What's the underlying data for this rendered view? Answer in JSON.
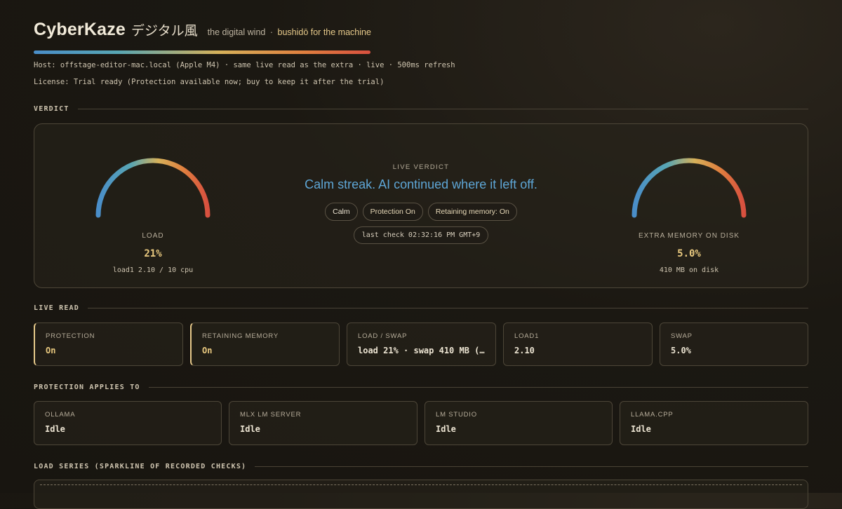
{
  "header": {
    "title": "CyberKaze",
    "title_jp": "デジタル風",
    "tagline_main": "the digital wind",
    "tagline_sep": "·",
    "tagline_accent": "bushidō for the machine",
    "host_line": "Host: offstage-editor-mac.local (Apple M4) · same live read as the extra · live · 500ms refresh",
    "license_line": "License: Trial ready (Protection available now; buy to keep it after the trial)"
  },
  "sections": {
    "verdict": "VERDICT",
    "live_read": "LIVE READ",
    "protection_applies": "PROTECTION APPLIES TO",
    "load_series": "LOAD SERIES (SPARKLINE OF RECORDED CHECKS)"
  },
  "verdict": {
    "load_gauge": {
      "label": "LOAD",
      "value": "21%",
      "sub": "load1 2.10 / 10 cpu",
      "fraction": 0.21
    },
    "disk_gauge": {
      "label": "EXTRA MEMORY ON DISK",
      "value": "5.0%",
      "sub": "410 MB on disk",
      "fraction": 0.05
    },
    "eyebrow": "LIVE VERDICT",
    "headline": "Calm streak. AI continued where it left off.",
    "chips": [
      "Calm",
      "Protection On",
      "Retaining memory: On"
    ],
    "last_check": "last check 02:32:16 PM GMT+9"
  },
  "live_read": [
    {
      "label": "PROTECTION",
      "value": "On"
    },
    {
      "label": "RETAINING MEMORY",
      "value": "On"
    },
    {
      "label": "LOAD / SWAP",
      "value": "load 21% · swap 410 MB (…"
    },
    {
      "label": "LOAD1",
      "value": "2.10"
    },
    {
      "label": "SWAP",
      "value": "5.0%"
    }
  ],
  "protection_targets": [
    {
      "label": "OLLAMA",
      "value": "Idle"
    },
    {
      "label": "MLX LM SERVER",
      "value": "Idle"
    },
    {
      "label": "LM STUDIO",
      "value": "Idle"
    },
    {
      "label": "LLAMA.CPP",
      "value": "Idle"
    }
  ],
  "colors": {
    "accent_gold": "#e9c97f",
    "accent_blue": "#5ea6d6",
    "gradient": [
      "#4a8ec9",
      "#58a6b3",
      "#d6b15a",
      "#e0803f",
      "#d8503f"
    ]
  }
}
